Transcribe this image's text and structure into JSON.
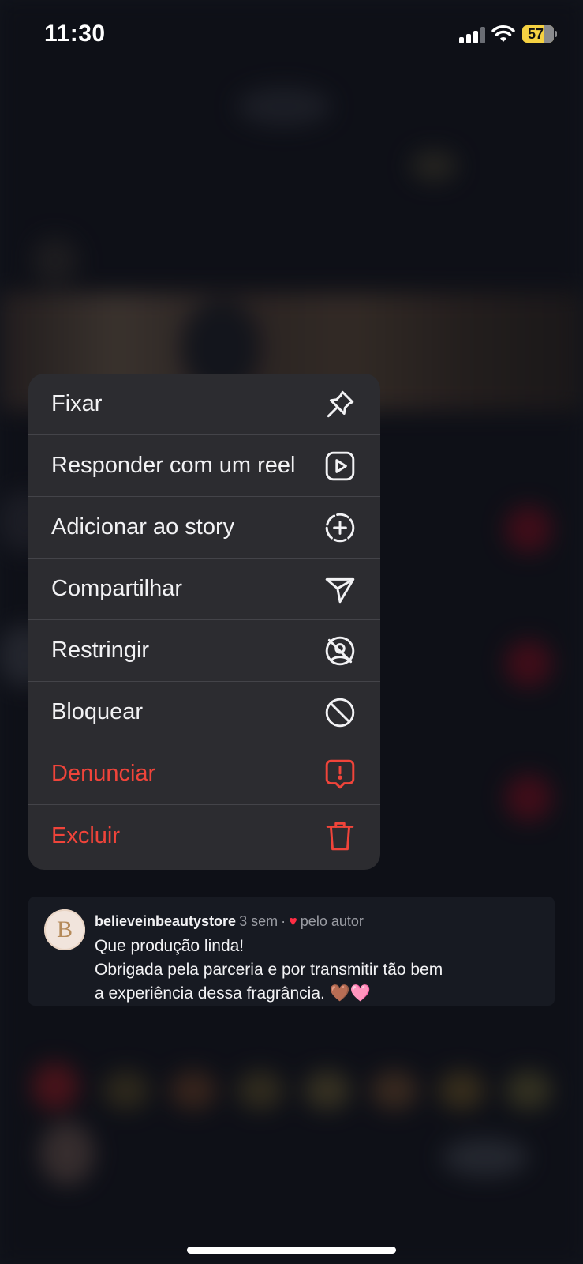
{
  "status_bar": {
    "time": "11:30",
    "battery": "57",
    "battery_color": "#f5d142"
  },
  "context_menu": {
    "items": [
      {
        "label": "Fixar",
        "icon": "pin-icon",
        "danger": false
      },
      {
        "label": "Responder com um reel",
        "icon": "reel-reply-icon",
        "danger": false
      },
      {
        "label": "Adicionar ao story",
        "icon": "add-story-icon",
        "danger": false
      },
      {
        "label": "Compartilhar",
        "icon": "share-send-icon",
        "danger": false
      },
      {
        "label": "Restringir",
        "icon": "restrict-icon",
        "danger": false
      },
      {
        "label": "Bloquear",
        "icon": "block-icon",
        "danger": false
      },
      {
        "label": "Denunciar",
        "icon": "report-icon",
        "danger": true
      },
      {
        "label": "Excluir",
        "icon": "trash-icon",
        "danger": true
      }
    ],
    "danger_color": "#f0443a"
  },
  "comment": {
    "avatar_letter": "B",
    "username": "believeinbeautystore",
    "time": "3 sem",
    "separator": "·",
    "liked_by": "pelo autor",
    "lines": [
      "Que produção linda!",
      "Obrigada pela parceria e por transmitir tão bem",
      "a experiência dessa fragrância. 🤎🩷"
    ]
  }
}
